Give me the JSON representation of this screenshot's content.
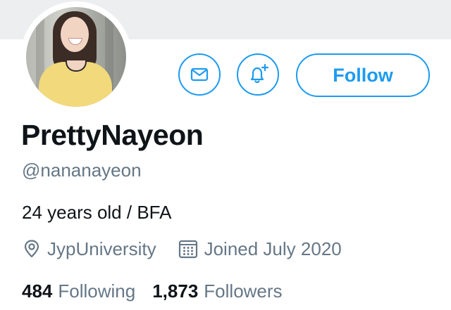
{
  "profile": {
    "display_name": "PrettyNayeon",
    "handle": "@nananayeon",
    "bio": "24 years old / BFA",
    "location": "JypUniversity",
    "joined": "Joined July 2020"
  },
  "actions": {
    "follow_label": "Follow",
    "message_icon": "mail-icon",
    "notify_icon": "bell-plus-icon"
  },
  "stats": {
    "following_count": "484",
    "following_label": "Following",
    "followers_count": "1,873",
    "followers_label": "Followers"
  },
  "colors": {
    "accent": "#1d9bf0",
    "secondary_text": "#657786",
    "primary_text": "#0f1419",
    "banner": "#eceef0"
  }
}
